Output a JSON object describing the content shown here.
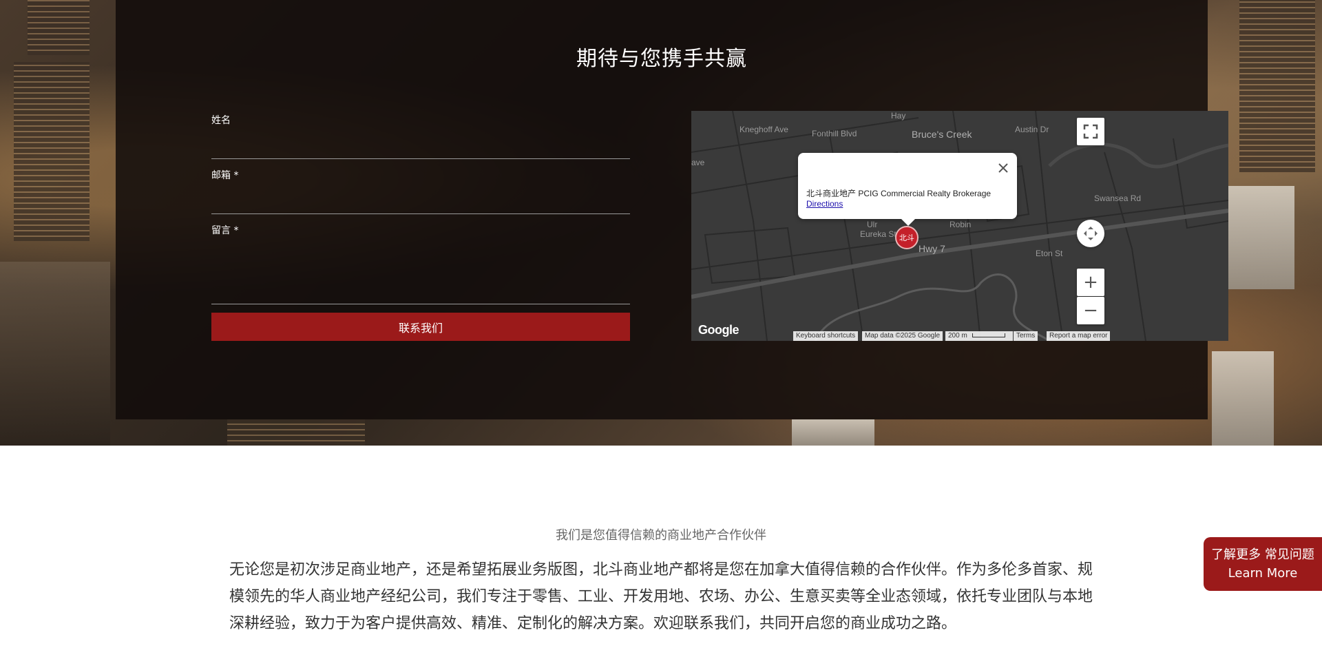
{
  "contact": {
    "title": "期待与您携手共赢",
    "name_label": "姓名",
    "email_label": "邮箱 *",
    "message_label": "留言 *",
    "submit_label": "联系我们"
  },
  "map": {
    "popup_title": "北斗商业地产 PCIG Commercial Realty Brokerage",
    "popup_link": "Directions",
    "marker_label": "北斗",
    "logo": "Google",
    "streets": [
      "Kneghoff Ave",
      "Fonthill Blvd",
      "Bruce's Creek",
      "Austin Dr",
      "ave",
      "Eureka St",
      "Hwy 7",
      "Eton St",
      "Swansea Rd",
      "Ulr",
      "Hay",
      "Robin"
    ],
    "attribution": {
      "shortcuts": "Keyboard shortcuts",
      "data": "Map data ©2025 Google",
      "scale": "200 m",
      "terms": "Terms",
      "report": "Report a map error"
    },
    "controls": {
      "zoom_in": "+",
      "zoom_out": "−"
    }
  },
  "about": {
    "tagline": "我们是您值得信赖的商业地产合作伙伴",
    "body": "无论您是初次涉足商业地产，还是希望拓展业务版图，北斗商业地产都将是您在加拿大值得信赖的合作伙伴。作为多伦多首家、规模领先的华人商业地产经纪公司，我们专注于零售、工业、开发用地、农场、办公、生意买卖等全业态领域，依托专业团队与本地深耕经验，致力于为客户提供高效、精准、定制化的解决方案。欢迎联系我们，共同开启您的商业成功之路。"
  },
  "floating": {
    "line1": "了解更多 常见问题",
    "line2": "Learn More"
  },
  "colors": {
    "accent": "#9b1a1a",
    "map_bg": "#3a3a3a"
  }
}
